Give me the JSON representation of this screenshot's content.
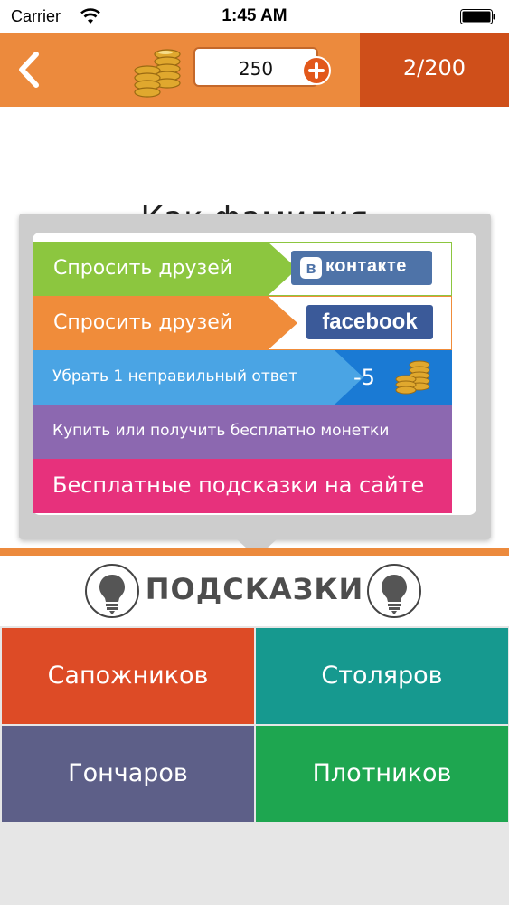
{
  "status_bar": {
    "carrier": "Carrier",
    "time": "1:45 AM",
    "icons": [
      "wifi-icon",
      "battery-icon"
    ]
  },
  "header": {
    "back_icon": "chevron-left-icon",
    "coin_count": "250",
    "add_icon": "plus-icon",
    "level": "2/200",
    "colors": {
      "bar": "#ec8a3d",
      "level_block": "#cf4f1a"
    }
  },
  "question": {
    "text": "Как фамилия"
  },
  "hints_popup": {
    "rows": [
      {
        "label": "Спросить друзей",
        "logo_badge": "в",
        "logo_text": "контакте",
        "color": "#8cc63f"
      },
      {
        "label": "Спросить друзей",
        "logo_text": "facebook",
        "color": "#f08c3a"
      },
      {
        "label": "Убрать 1 неправильный ответ",
        "cost": "-5",
        "color": "#4aa4e4"
      },
      {
        "label": "Купить или получить бесплатно монетки",
        "color": "#8c68b0"
      },
      {
        "label": "Бесплатные подсказки на сайте",
        "color": "#e7317c"
      }
    ]
  },
  "hints_bar": {
    "title": "ПОДСКАЗКИ",
    "icon": "lightbulb-icon"
  },
  "answers": [
    {
      "label": "Сапожников",
      "color": "#dd4b26"
    },
    {
      "label": "Столяров",
      "color": "#16998f"
    },
    {
      "label": "Гончаров",
      "color": "#5d5f88"
    },
    {
      "label": "Плотников",
      "color": "#1ea650"
    }
  ]
}
